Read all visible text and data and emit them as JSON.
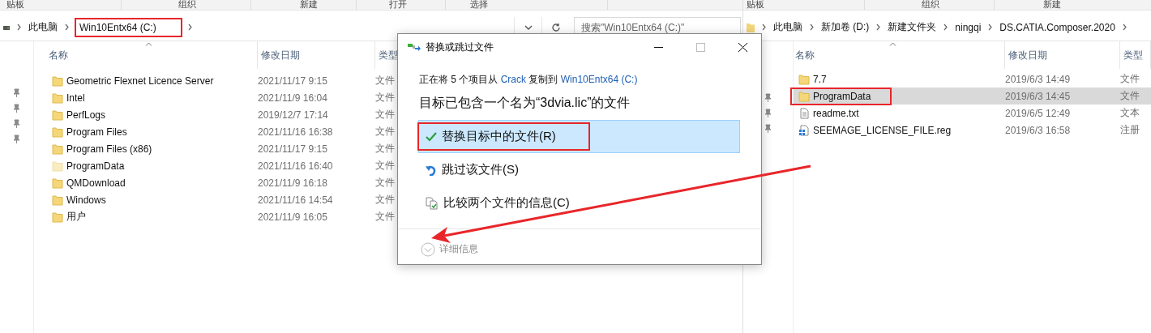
{
  "left_window": {
    "ribbon_groups": [
      "贴板",
      "组织",
      "新建",
      "打开",
      "选择"
    ],
    "breadcrumbs": [
      {
        "label": "此电脑",
        "annotated": false
      },
      {
        "label": "Win10Entx64 (C:)",
        "annotated": true
      }
    ],
    "search": {
      "placeholder": "搜索\"Win10Entx64 (C:)\""
    },
    "columns": [
      "名称",
      "修改日期",
      "类型"
    ],
    "rows": [
      {
        "name": "Geometric Flexnet Licence Server",
        "date": "2021/11/17 9:15",
        "type": "文件",
        "kind": "folder",
        "hidden": false
      },
      {
        "name": "Intel",
        "date": "2021/11/9 16:04",
        "type": "文件",
        "kind": "folder",
        "hidden": false
      },
      {
        "name": "PerfLogs",
        "date": "2019/12/7 17:14",
        "type": "文件",
        "kind": "folder",
        "hidden": false
      },
      {
        "name": "Program Files",
        "date": "2021/11/16 16:38",
        "type": "文件",
        "kind": "folder",
        "hidden": false
      },
      {
        "name": "Program Files (x86)",
        "date": "2021/11/17 9:15",
        "type": "文件",
        "kind": "folder",
        "hidden": false
      },
      {
        "name": "ProgramData",
        "date": "2021/11/16 16:40",
        "type": "文件",
        "kind": "folder",
        "hidden": true
      },
      {
        "name": "QMDownload",
        "date": "2021/11/9 16:18",
        "type": "文件",
        "kind": "folder",
        "hidden": false
      },
      {
        "name": "Windows",
        "date": "2021/11/16 14:54",
        "type": "文件",
        "kind": "folder",
        "hidden": false
      },
      {
        "name": "用户",
        "date": "2021/11/9 16:05",
        "type": "文件",
        "kind": "folder",
        "hidden": false
      }
    ]
  },
  "right_window": {
    "ribbon_groups": [
      "贴板",
      "组织",
      "新建"
    ],
    "breadcrumbs": [
      {
        "label": "此电脑",
        "annotated": false
      },
      {
        "label": "新加卷 (D:)",
        "annotated": false
      },
      {
        "label": "新建文件夹",
        "annotated": false
      },
      {
        "label": "ningqi",
        "annotated": false
      },
      {
        "label": "DS.CATIA.Composer.2020",
        "annotated": false
      }
    ],
    "columns": [
      "名称",
      "修改日期",
      "类型"
    ],
    "rows": [
      {
        "name": "7.7",
        "date": "2019/6/3 14:49",
        "type": "文件",
        "kind": "folder",
        "selected": false,
        "annotated": false
      },
      {
        "name": "ProgramData",
        "date": "2019/6/3 14:45",
        "type": "文件",
        "kind": "folder",
        "selected": true,
        "annotated": true
      },
      {
        "name": "readme.txt",
        "date": "2019/6/5 12:49",
        "type": "文本",
        "kind": "text",
        "selected": false,
        "annotated": false
      },
      {
        "name": "SEEMAGE_LICENSE_FILE.reg",
        "date": "2019/6/3 16:58",
        "type": "注册",
        "kind": "registry",
        "selected": false,
        "annotated": false
      }
    ]
  },
  "dialog": {
    "title": "替换或跳过文件",
    "info": [
      {
        "kind": "text",
        "text": "正在将 5 个项目从"
      },
      {
        "kind": "link",
        "text": "Crack"
      },
      {
        "kind": "text",
        "text": "复制到"
      },
      {
        "kind": "link",
        "text": "Win10Entx64 (C:)"
      }
    ],
    "heading": "目标已包含一个名为“3dvia.lic”的文件",
    "options": [
      {
        "kind": "replace",
        "label": "替换目标中的文件(R)",
        "selected": true,
        "annotated": true
      },
      {
        "kind": "skip",
        "label": "跳过该文件(S)",
        "selected": false,
        "annotated": false
      },
      {
        "kind": "compare",
        "label": "比较两个文件的信息(C)",
        "selected": false,
        "annotated": false
      }
    ],
    "details": {
      "label": "详细信息",
      "expanded": false
    }
  }
}
